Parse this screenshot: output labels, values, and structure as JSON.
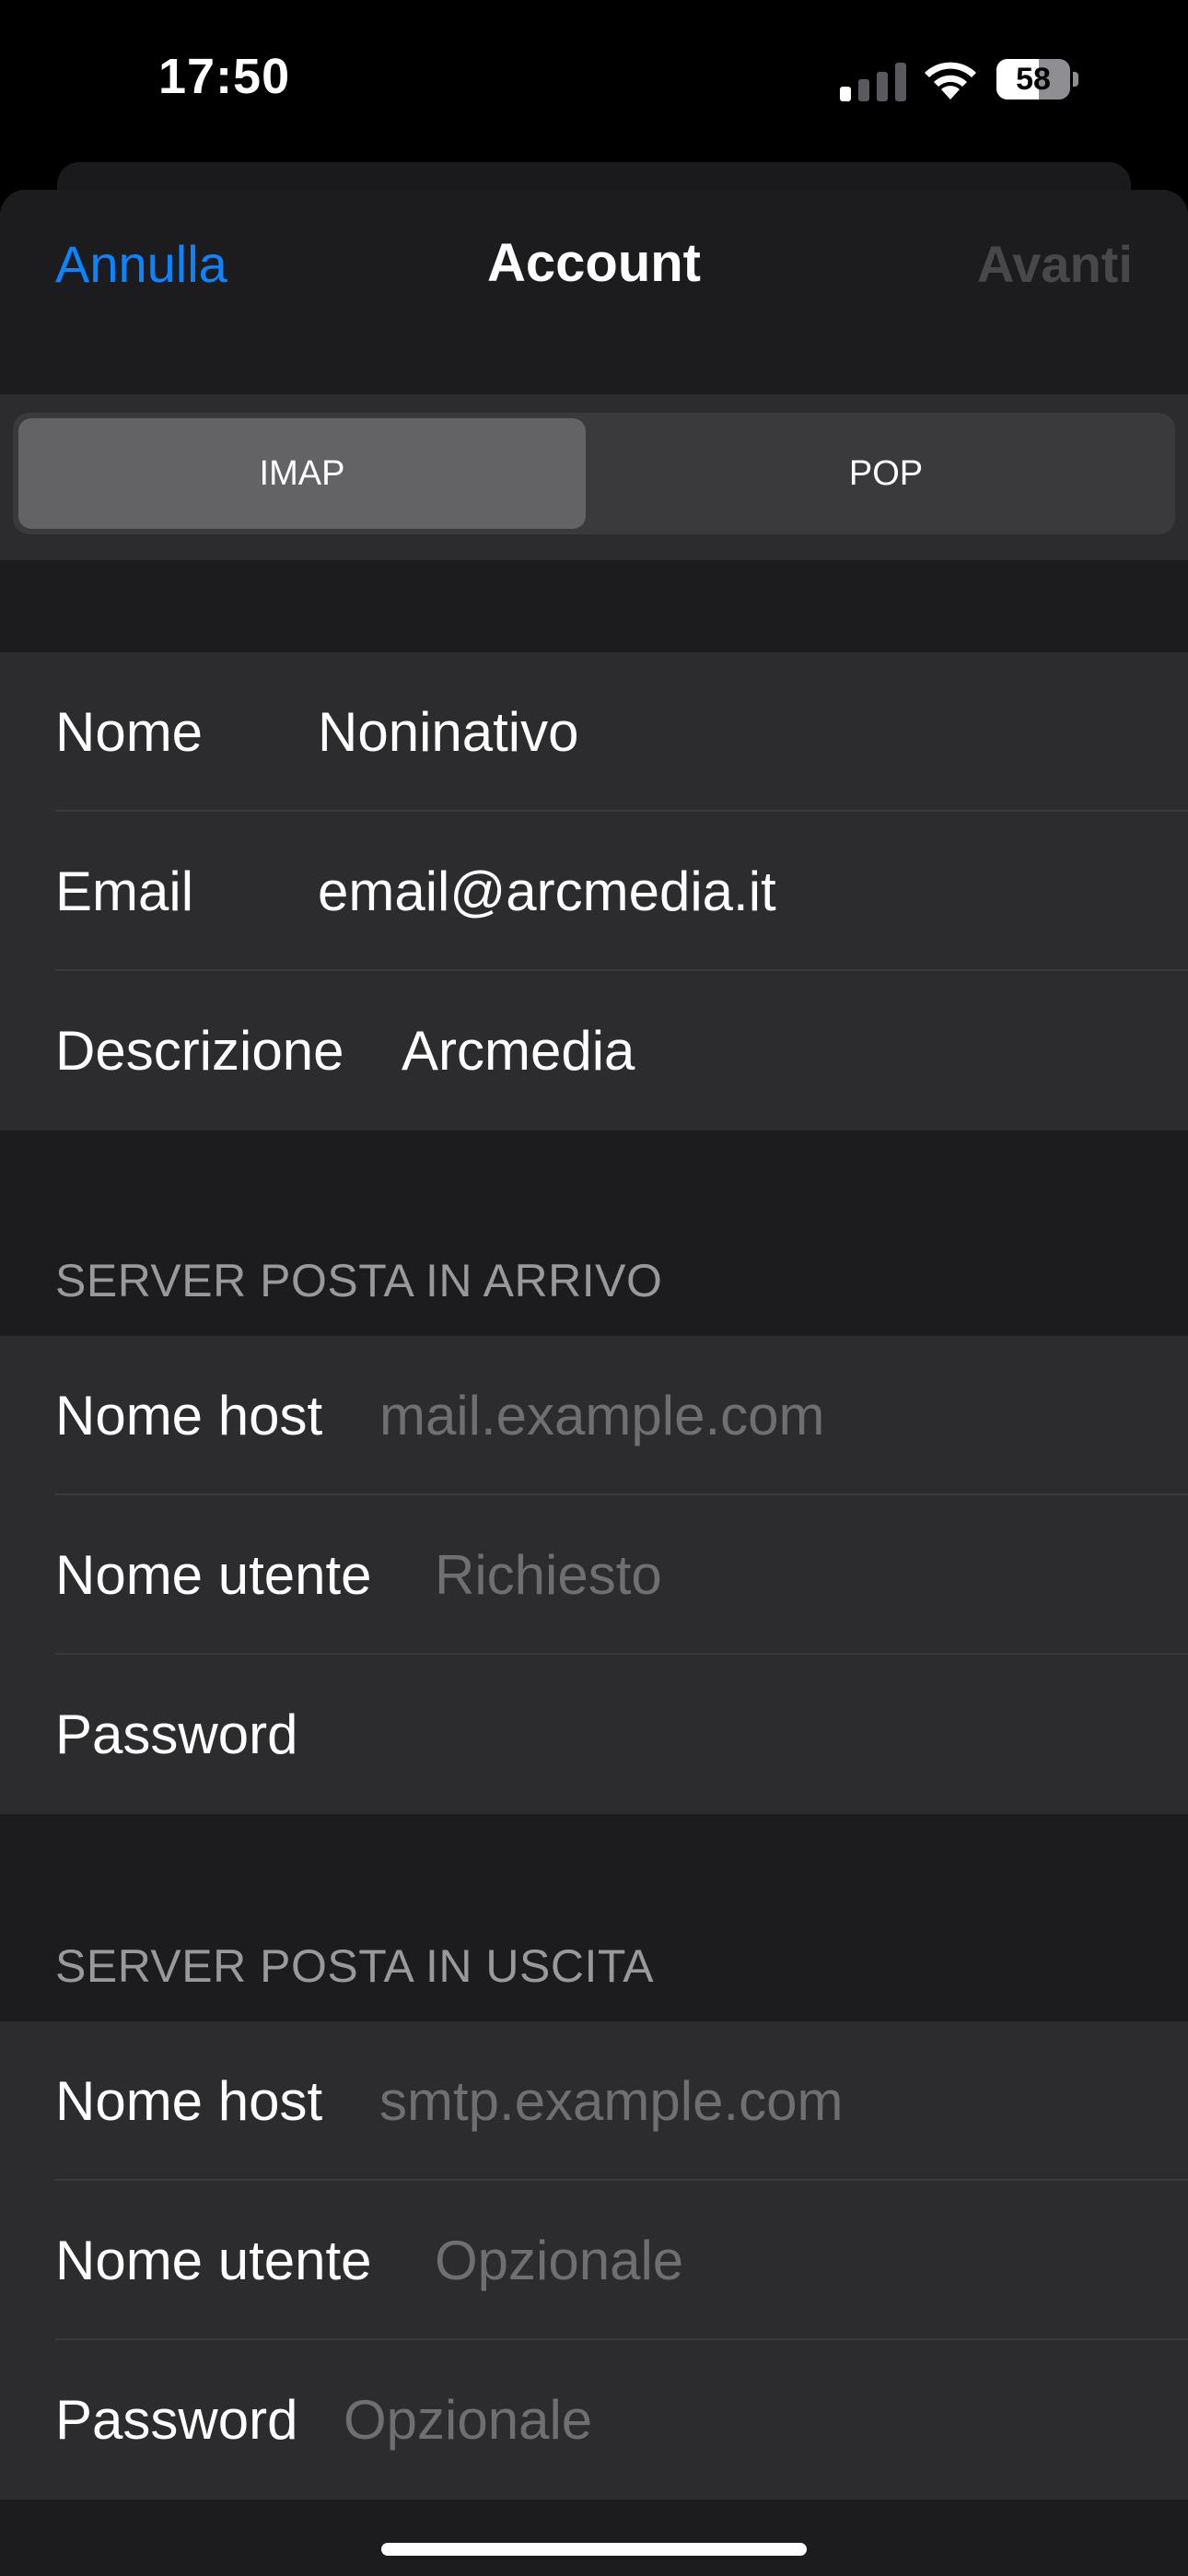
{
  "status_bar": {
    "time": "17:50",
    "battery_percent": "58",
    "signal_bars_active": 1,
    "signal_bars_total": 4
  },
  "nav": {
    "cancel": "Annulla",
    "title": "Account",
    "next": "Avanti"
  },
  "segments": {
    "imap": "IMAP",
    "pop": "POP",
    "selected": "IMAP"
  },
  "account": {
    "name_label": "Nome",
    "name_value": "Noninativo",
    "email_label": "Email",
    "email_value": "email@arcmedia.it",
    "description_label": "Descrizione",
    "description_value": "Arcmedia"
  },
  "incoming": {
    "header": "SERVER POSTA IN ARRIVO",
    "host_label": "Nome host",
    "host_placeholder": "mail.example.com",
    "user_label": "Nome utente",
    "user_placeholder": "Richiesto",
    "password_label": "Password"
  },
  "outgoing": {
    "header": "SERVER POSTA IN USCITA",
    "host_label": "Nome host",
    "host_placeholder": "smtp.example.com",
    "user_label": "Nome utente",
    "user_placeholder": "Opzionale",
    "password_label": "Password",
    "password_placeholder": "Opzionale"
  },
  "colors": {
    "accent": "#0a84ff",
    "background": "#1c1c1e",
    "cell": "#2c2c2e",
    "placeholder": "#6e6e73",
    "disabled": "#48484a"
  }
}
